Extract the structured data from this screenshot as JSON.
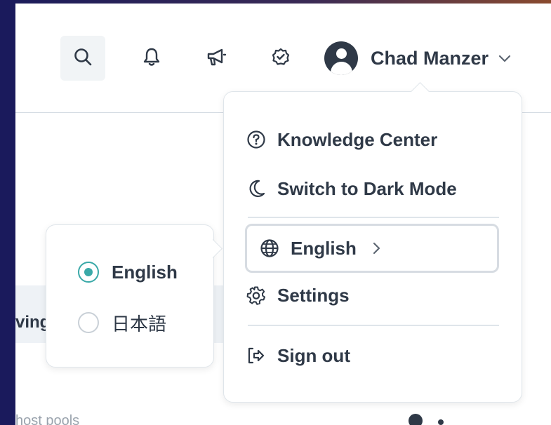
{
  "header": {
    "user_name": "Chad Manzer",
    "icons": [
      "search-icon",
      "bell-icon",
      "megaphone-icon",
      "check-badge-icon",
      "user-avatar-icon",
      "chevron-down-icon"
    ]
  },
  "background": {
    "band_text": "ving",
    "bottom_text": "host pools"
  },
  "user_menu": {
    "items": [
      {
        "label": "Knowledge Center",
        "icon": "help-circle-icon"
      },
      {
        "label": "Switch to Dark Mode",
        "icon": "moon-icon"
      },
      {
        "label": "English",
        "icon": "globe-icon"
      },
      {
        "label": "Settings",
        "icon": "gear-icon"
      },
      {
        "label": "Sign out",
        "icon": "sign-out-icon"
      }
    ]
  },
  "language_popover": {
    "options": [
      {
        "label": "English",
        "selected": true
      },
      {
        "label": "日本語",
        "selected": false
      }
    ]
  },
  "colors": {
    "accent": "#3aa9a8",
    "text": "#2f3947",
    "border": "#dfe5ea",
    "background_outer": "#1c1c5a"
  }
}
